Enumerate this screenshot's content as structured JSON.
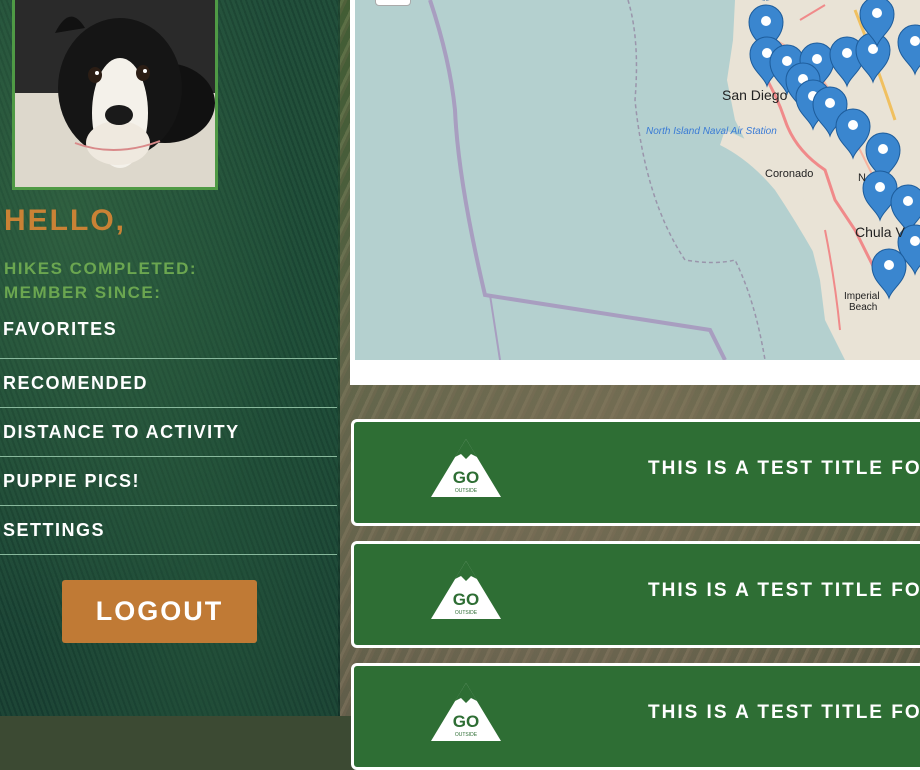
{
  "sidebar": {
    "greeting": "Hello,",
    "hikes_completed_label": "Hikes Completed:",
    "member_since_label": "Member Since:",
    "nav": [
      {
        "label": "Favorites"
      },
      {
        "label": "Recomended"
      },
      {
        "label": "Distance to Activity"
      },
      {
        "label": "Puppie Pics!"
      },
      {
        "label": "Settings"
      }
    ],
    "logout_label": "Logout"
  },
  "map": {
    "labels": {
      "san_diego": "San Diego",
      "naval_station": "North Island Naval Air Station",
      "coronado": "Coronado",
      "chula_vista": "Chula V",
      "national_city": "N",
      "imperial_beach": "Imperial",
      "imperial_beach_2": "Beach"
    },
    "marker_color": "#3a86cf"
  },
  "cards": [
    {
      "title": "This is a test title for",
      "logo_text": "GO",
      "logo_sub": "OUTSIDE",
      "icon": "mountain-logo-icon"
    },
    {
      "title": "This is a test title for",
      "logo_text": "GO",
      "logo_sub": "OUTSIDE",
      "icon": "mountain-logo-icon"
    },
    {
      "title": "This is a test title for",
      "logo_text": "GO",
      "logo_sub": "OUTSIDE",
      "icon": "mountain-logo-icon"
    }
  ],
  "colors": {
    "accent_orange": "#c98235",
    "accent_green": "#6ba650",
    "card_green": "#2e6e34"
  }
}
